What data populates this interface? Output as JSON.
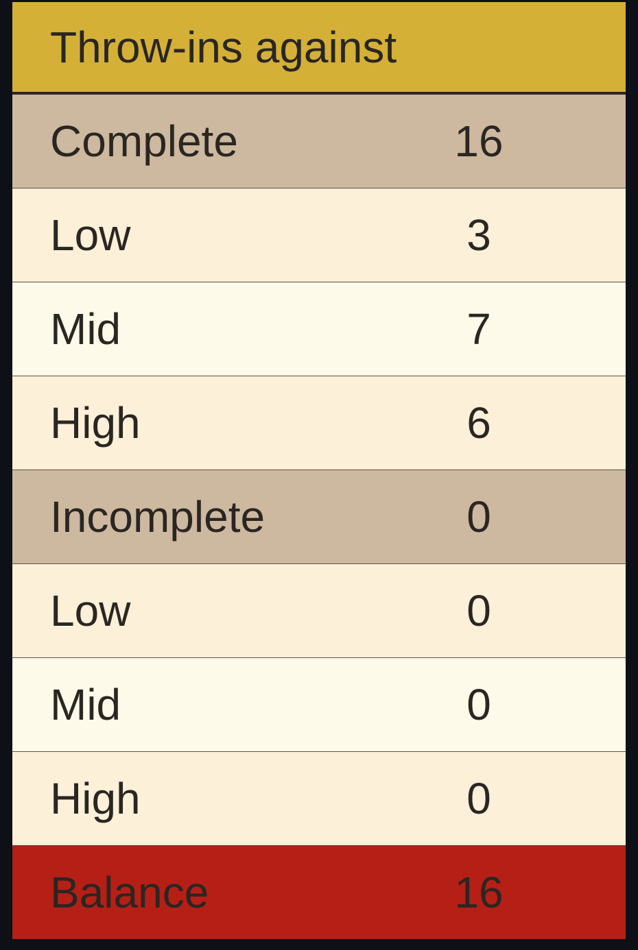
{
  "table": {
    "title": "Throw-ins against",
    "rows": [
      {
        "label": "Complete",
        "value": "16"
      },
      {
        "label": "Low",
        "value": "3"
      },
      {
        "label": "Mid",
        "value": "7"
      },
      {
        "label": "High",
        "value": "6"
      },
      {
        "label": "Incomplete",
        "value": "0"
      },
      {
        "label": "Low",
        "value": "0"
      },
      {
        "label": "Mid",
        "value": "0"
      },
      {
        "label": "High",
        "value": "0"
      }
    ],
    "balance": {
      "label": "Balance",
      "value": "16"
    }
  },
  "colors": {
    "header": "#d4b037",
    "group_row": "#cdb8a0",
    "row_light": "#fefae9",
    "row_cream": "#fdf0d8",
    "balance_row": "#b51f16",
    "background": "#0d1017"
  }
}
